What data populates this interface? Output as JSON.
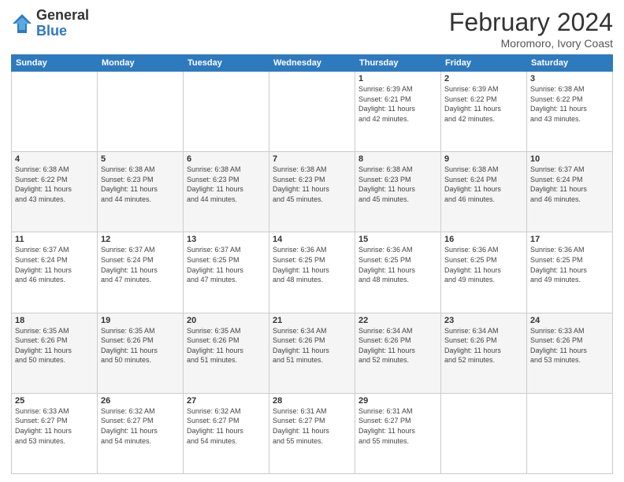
{
  "logo": {
    "general": "General",
    "blue": "Blue"
  },
  "title": "February 2024",
  "subtitle": "Moromoro, Ivory Coast",
  "days_header": [
    "Sunday",
    "Monday",
    "Tuesday",
    "Wednesday",
    "Thursday",
    "Friday",
    "Saturday"
  ],
  "weeks": [
    [
      {
        "day": "",
        "info": ""
      },
      {
        "day": "",
        "info": ""
      },
      {
        "day": "",
        "info": ""
      },
      {
        "day": "",
        "info": ""
      },
      {
        "day": "1",
        "info": "Sunrise: 6:39 AM\nSunset: 6:21 PM\nDaylight: 11 hours\nand 42 minutes."
      },
      {
        "day": "2",
        "info": "Sunrise: 6:39 AM\nSunset: 6:22 PM\nDaylight: 11 hours\nand 42 minutes."
      },
      {
        "day": "3",
        "info": "Sunrise: 6:38 AM\nSunset: 6:22 PM\nDaylight: 11 hours\nand 43 minutes."
      }
    ],
    [
      {
        "day": "4",
        "info": "Sunrise: 6:38 AM\nSunset: 6:22 PM\nDaylight: 11 hours\nand 43 minutes."
      },
      {
        "day": "5",
        "info": "Sunrise: 6:38 AM\nSunset: 6:23 PM\nDaylight: 11 hours\nand 44 minutes."
      },
      {
        "day": "6",
        "info": "Sunrise: 6:38 AM\nSunset: 6:23 PM\nDaylight: 11 hours\nand 44 minutes."
      },
      {
        "day": "7",
        "info": "Sunrise: 6:38 AM\nSunset: 6:23 PM\nDaylight: 11 hours\nand 45 minutes."
      },
      {
        "day": "8",
        "info": "Sunrise: 6:38 AM\nSunset: 6:23 PM\nDaylight: 11 hours\nand 45 minutes."
      },
      {
        "day": "9",
        "info": "Sunrise: 6:38 AM\nSunset: 6:24 PM\nDaylight: 11 hours\nand 46 minutes."
      },
      {
        "day": "10",
        "info": "Sunrise: 6:37 AM\nSunset: 6:24 PM\nDaylight: 11 hours\nand 46 minutes."
      }
    ],
    [
      {
        "day": "11",
        "info": "Sunrise: 6:37 AM\nSunset: 6:24 PM\nDaylight: 11 hours\nand 46 minutes."
      },
      {
        "day": "12",
        "info": "Sunrise: 6:37 AM\nSunset: 6:24 PM\nDaylight: 11 hours\nand 47 minutes."
      },
      {
        "day": "13",
        "info": "Sunrise: 6:37 AM\nSunset: 6:25 PM\nDaylight: 11 hours\nand 47 minutes."
      },
      {
        "day": "14",
        "info": "Sunrise: 6:36 AM\nSunset: 6:25 PM\nDaylight: 11 hours\nand 48 minutes."
      },
      {
        "day": "15",
        "info": "Sunrise: 6:36 AM\nSunset: 6:25 PM\nDaylight: 11 hours\nand 48 minutes."
      },
      {
        "day": "16",
        "info": "Sunrise: 6:36 AM\nSunset: 6:25 PM\nDaylight: 11 hours\nand 49 minutes."
      },
      {
        "day": "17",
        "info": "Sunrise: 6:36 AM\nSunset: 6:25 PM\nDaylight: 11 hours\nand 49 minutes."
      }
    ],
    [
      {
        "day": "18",
        "info": "Sunrise: 6:35 AM\nSunset: 6:26 PM\nDaylight: 11 hours\nand 50 minutes."
      },
      {
        "day": "19",
        "info": "Sunrise: 6:35 AM\nSunset: 6:26 PM\nDaylight: 11 hours\nand 50 minutes."
      },
      {
        "day": "20",
        "info": "Sunrise: 6:35 AM\nSunset: 6:26 PM\nDaylight: 11 hours\nand 51 minutes."
      },
      {
        "day": "21",
        "info": "Sunrise: 6:34 AM\nSunset: 6:26 PM\nDaylight: 11 hours\nand 51 minutes."
      },
      {
        "day": "22",
        "info": "Sunrise: 6:34 AM\nSunset: 6:26 PM\nDaylight: 11 hours\nand 52 minutes."
      },
      {
        "day": "23",
        "info": "Sunrise: 6:34 AM\nSunset: 6:26 PM\nDaylight: 11 hours\nand 52 minutes."
      },
      {
        "day": "24",
        "info": "Sunrise: 6:33 AM\nSunset: 6:26 PM\nDaylight: 11 hours\nand 53 minutes."
      }
    ],
    [
      {
        "day": "25",
        "info": "Sunrise: 6:33 AM\nSunset: 6:27 PM\nDaylight: 11 hours\nand 53 minutes."
      },
      {
        "day": "26",
        "info": "Sunrise: 6:32 AM\nSunset: 6:27 PM\nDaylight: 11 hours\nand 54 minutes."
      },
      {
        "day": "27",
        "info": "Sunrise: 6:32 AM\nSunset: 6:27 PM\nDaylight: 11 hours\nand 54 minutes."
      },
      {
        "day": "28",
        "info": "Sunrise: 6:31 AM\nSunset: 6:27 PM\nDaylight: 11 hours\nand 55 minutes."
      },
      {
        "day": "29",
        "info": "Sunrise: 6:31 AM\nSunset: 6:27 PM\nDaylight: 11 hours\nand 55 minutes."
      },
      {
        "day": "",
        "info": ""
      },
      {
        "day": "",
        "info": ""
      }
    ]
  ]
}
